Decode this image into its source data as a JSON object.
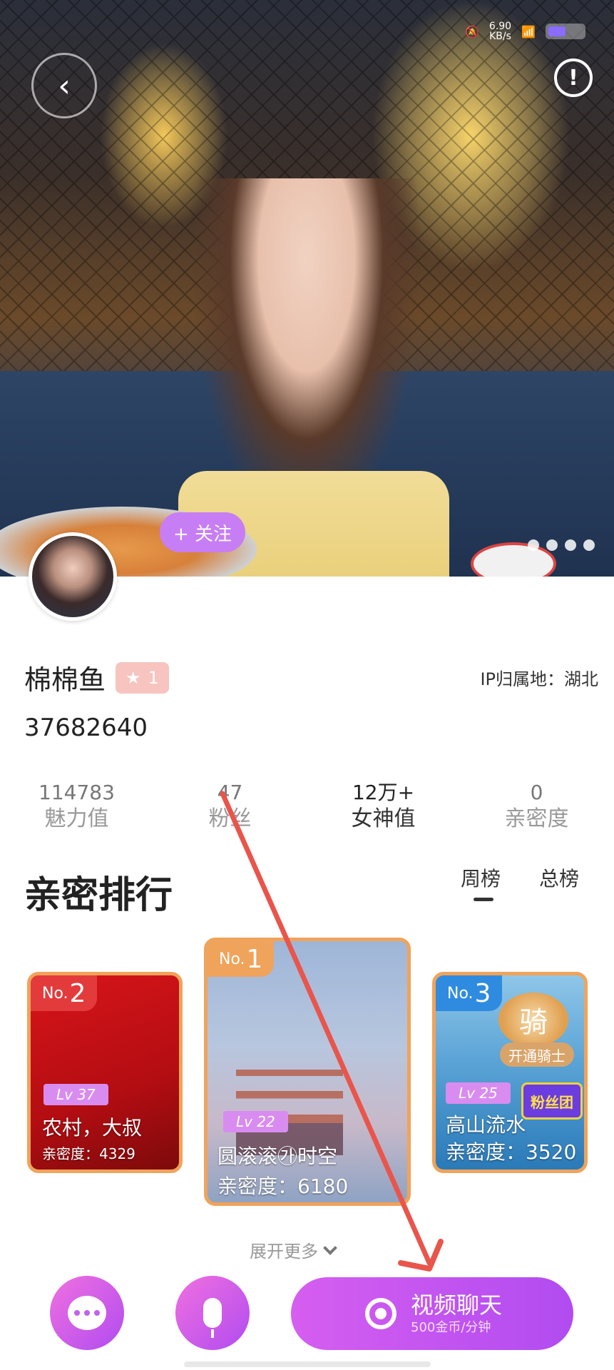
{
  "status_bar": {
    "speed": "6.90",
    "speed_unit": "KB/s"
  },
  "profile": {
    "follow_label": "+ 关注",
    "name": "棉棉鱼",
    "level": "1",
    "ip": "IP归属地：湖北",
    "uid": "37682640"
  },
  "stats": [
    {
      "value": "114783",
      "label": "魅力值"
    },
    {
      "value": "47",
      "label": "粉丝"
    },
    {
      "value": "12万+",
      "label": "女神值"
    },
    {
      "value": "0",
      "label": "亲密度"
    }
  ],
  "ranking": {
    "title": "亲密排行",
    "tabs": {
      "week": "周榜",
      "total": "总榜"
    },
    "rank_prefix": "No.",
    "cards": [
      {
        "rank": "1",
        "level": "Lv 22",
        "name": "圆滚滚㉮时空",
        "score": "亲密度：6180"
      },
      {
        "rank": "2",
        "level": "Lv 37",
        "name": "农村，大叔",
        "score": "亲密度：4329"
      },
      {
        "rank": "3",
        "level": "Lv 25",
        "name": "高山流水",
        "score": "亲密度：3520",
        "knight_char": "骑",
        "knight_label": "开通骑士",
        "fan_badge": "粉丝团"
      }
    ],
    "more_label": "展开更多"
  },
  "actions": {
    "video_label": "视频聊天",
    "video_price": "500金币/分钟"
  },
  "colors": {
    "accent": "#b14cf0",
    "annotation_arrow": "#e9554b"
  }
}
